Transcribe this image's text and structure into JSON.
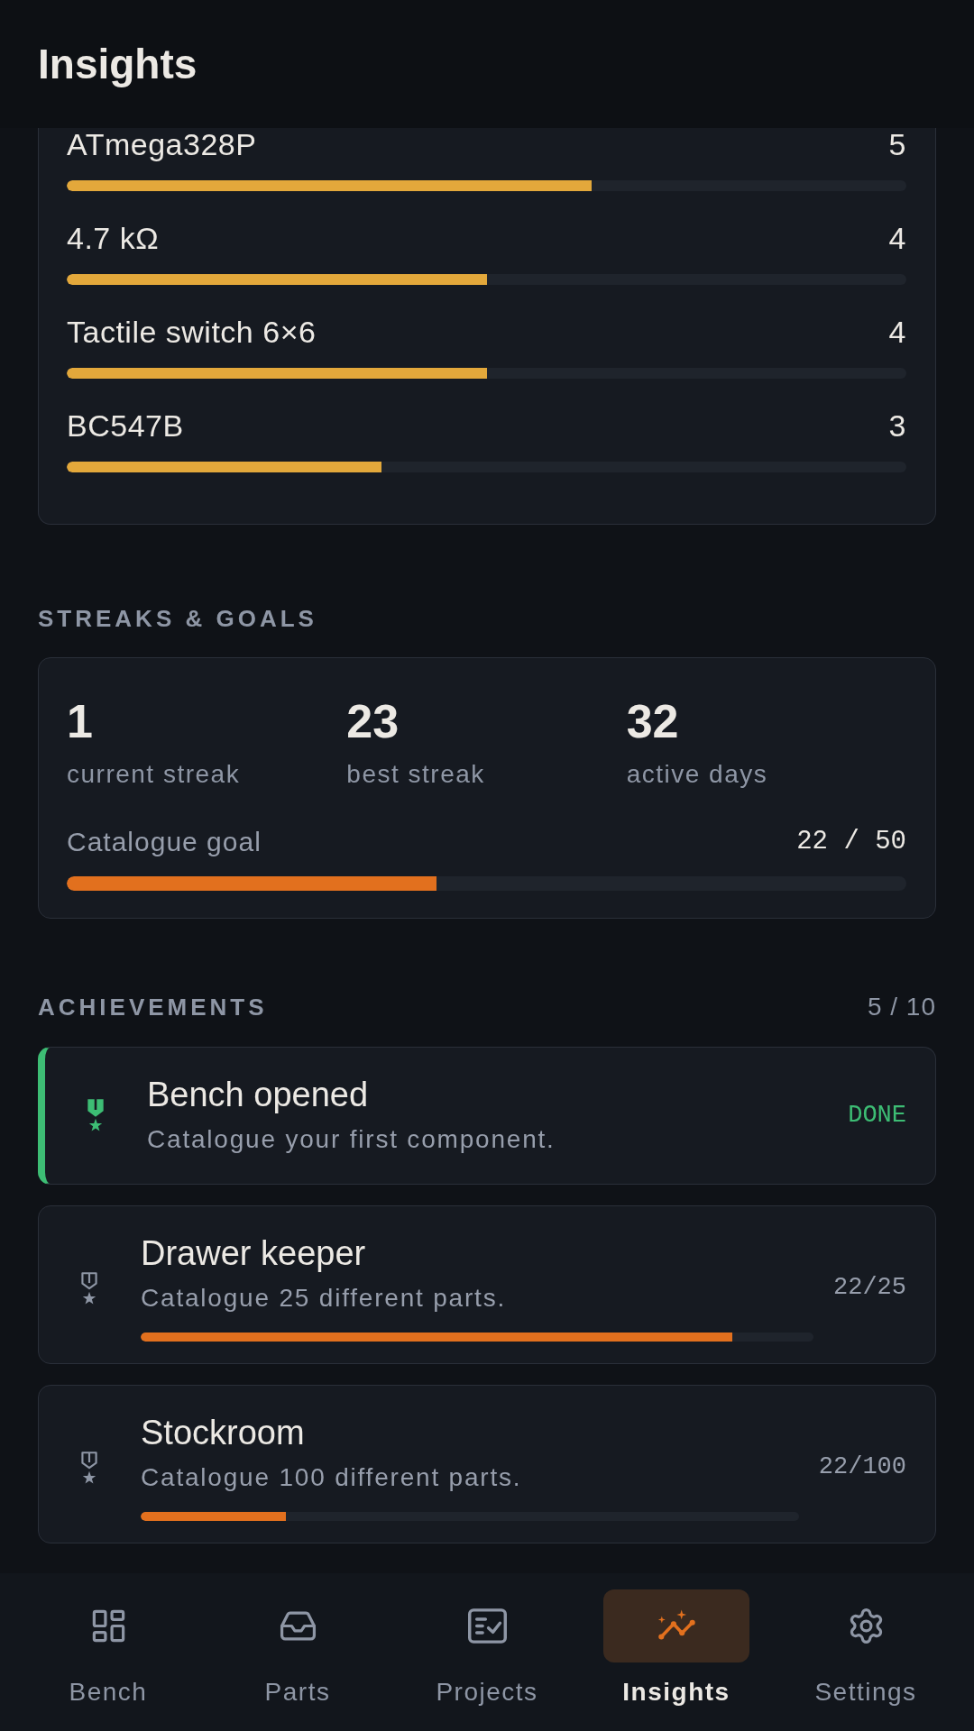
{
  "header": {
    "title": "Insights"
  },
  "part_counts": {
    "rows": [
      {
        "name": "ATmega328P",
        "count": "5",
        "level": 0.625
      },
      {
        "name": "4.7 kΩ",
        "count": "4",
        "level": 0.5
      },
      {
        "name": "Tactile switch 6×6",
        "count": "4",
        "level": 0.5
      },
      {
        "name": "BC547B",
        "count": "3",
        "level": 0.375
      }
    ]
  },
  "streaks": {
    "heading": "STREAKS & GOALS",
    "stats": [
      {
        "value": "1",
        "label": "current streak"
      },
      {
        "value": "23",
        "label": "best streak"
      },
      {
        "value": "32",
        "label": "active days"
      }
    ],
    "goal": {
      "label": "Catalogue goal",
      "reading": "22 / 50",
      "level": 0.44
    }
  },
  "achievements": {
    "heading": "ACHIEVEMENTS",
    "count": "5 / 10",
    "items": [
      {
        "title": "Bench opened",
        "description": "Catalogue your first component.",
        "done": true,
        "status": "DONE"
      },
      {
        "title": "Drawer keeper",
        "description": "Catalogue 25 different parts.",
        "done": false,
        "progress": "22/25",
        "level": 0.88
      },
      {
        "title": "Stockroom",
        "description": "Catalogue 100 different parts.",
        "done": false,
        "progress": "22/100",
        "level": 0.22
      }
    ]
  },
  "nav": {
    "items": [
      {
        "label": "Bench",
        "selected": false
      },
      {
        "label": "Parts",
        "selected": false
      },
      {
        "label": "Projects",
        "selected": false
      },
      {
        "label": "Insights",
        "selected": true
      },
      {
        "label": "Settings",
        "selected": false
      }
    ]
  }
}
